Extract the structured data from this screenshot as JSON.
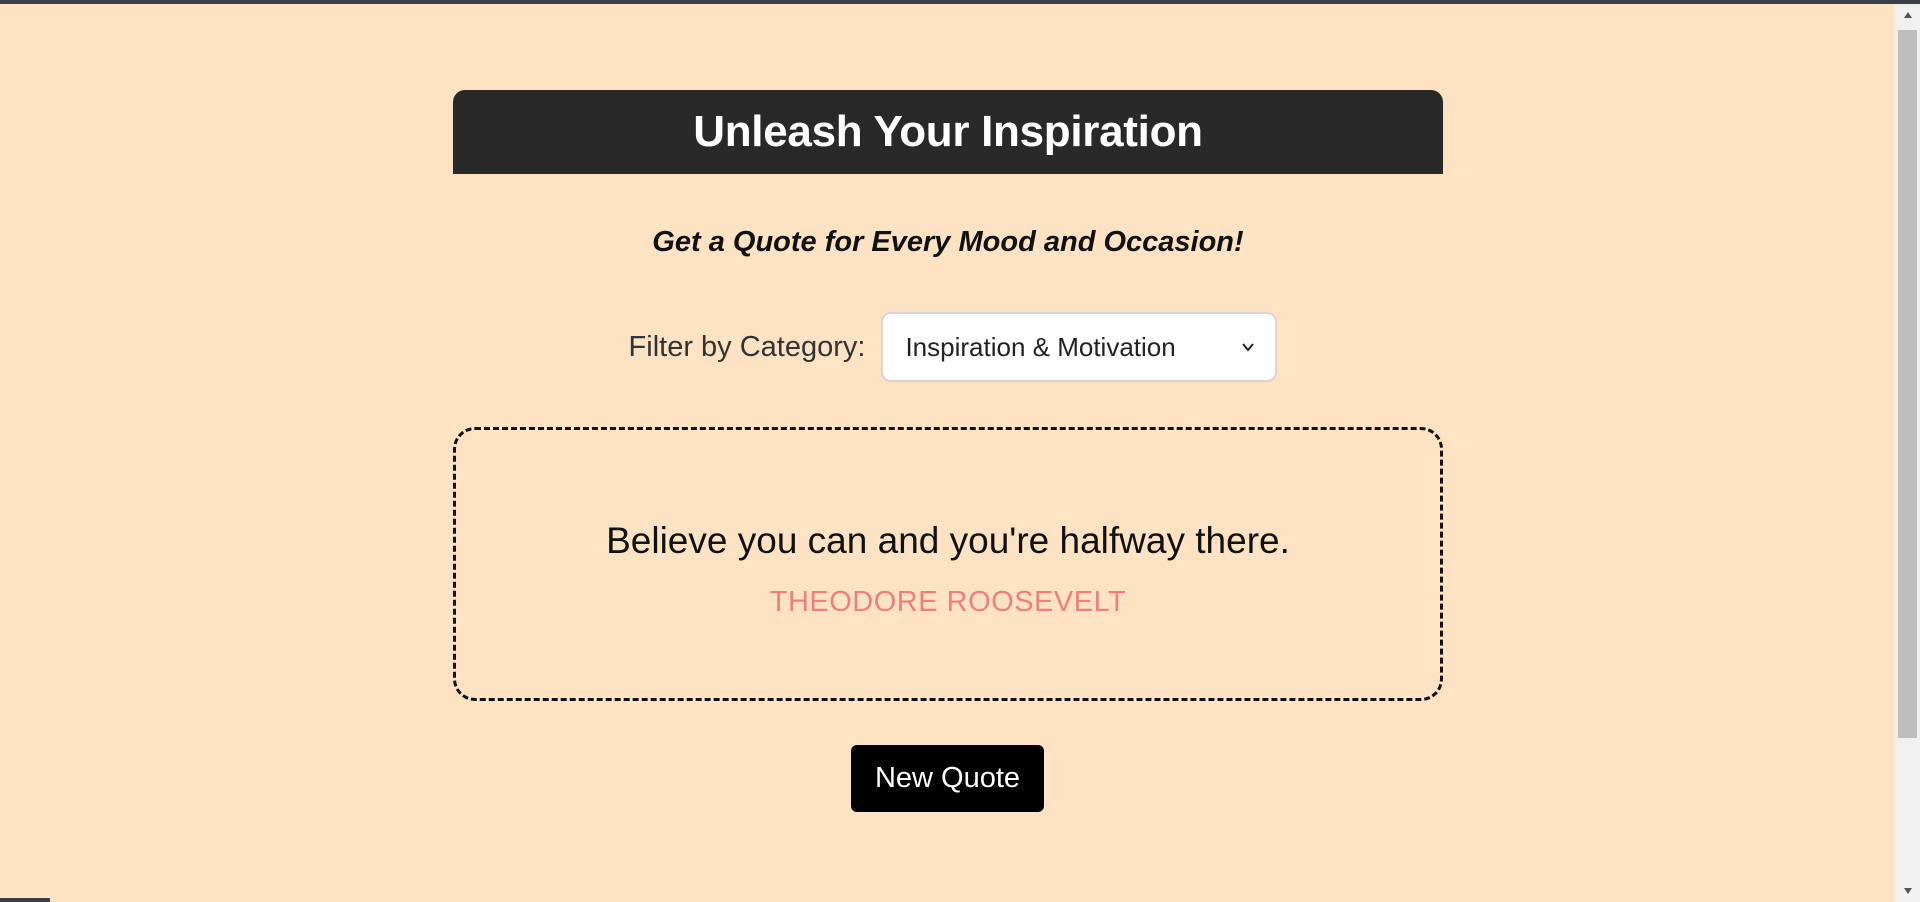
{
  "header": {
    "title": "Unleash Your Inspiration"
  },
  "subtitle": "Get a Quote for Every Mood and Occasion!",
  "filter": {
    "label": "Filter by Category:",
    "selected": "Inspiration & Motivation"
  },
  "quote": {
    "text": "Believe you can and you're halfway there.",
    "author": "THEODORE ROOSEVELT"
  },
  "actions": {
    "new_quote_label": "New Quote"
  },
  "icons": {
    "select_arrow": "chevron-down-icon",
    "scroll_up": "scroll-up-arrow-icon",
    "scroll_down": "scroll-down-arrow-icon"
  },
  "colors": {
    "background": "#fde3c3",
    "header_bg": "#292929",
    "author_color": "#ef7f7f",
    "button_bg": "#000000"
  }
}
